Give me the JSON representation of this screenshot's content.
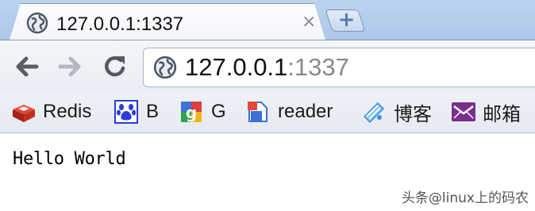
{
  "tab": {
    "title": "127.0.0.1:1337",
    "close_glyph": "×",
    "icon": "globe-icon"
  },
  "new_tab": {
    "glyph": "+",
    "icon": "plus-icon"
  },
  "toolbar": {
    "back_icon": "back-arrow-icon",
    "forward_icon": "forward-arrow-icon",
    "reload_icon": "reload-icon"
  },
  "omnibox": {
    "host": "127.0.0.1",
    "port_part": ":1337",
    "icon": "globe-icon"
  },
  "bookmarks": [
    {
      "label": "Redis",
      "icon": "redis-icon",
      "color": "#c82f24"
    },
    {
      "label": "B",
      "icon": "baidu-paw-icon",
      "color": "#2b3cd6"
    },
    {
      "label": "G",
      "icon": "google-icon",
      "color": "#3b74d6"
    },
    {
      "label": "reader",
      "icon": "reader-icon",
      "color": "#3a6fd8"
    },
    {
      "label": "博客",
      "icon": "blog-icon",
      "color": "#3f8ee0"
    },
    {
      "label": "邮箱",
      "icon": "mail-icon",
      "color": "#7a2f8c"
    }
  ],
  "page": {
    "text": "Hello World"
  },
  "watermark": "头条@linux上的码农"
}
